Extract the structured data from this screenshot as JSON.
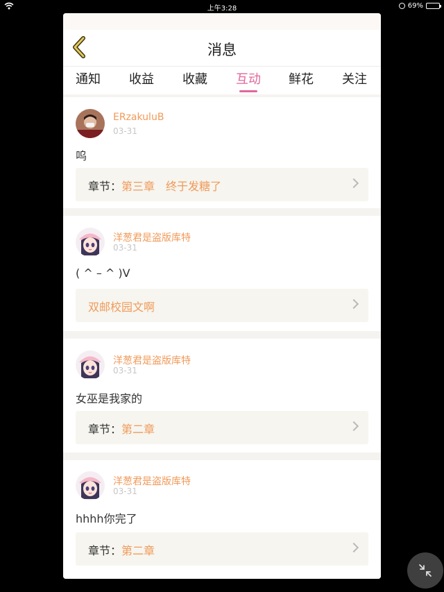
{
  "status_bar": {
    "time": "上午3:28",
    "battery_text": "69%",
    "battery_level": 0.69
  },
  "header": {
    "title": "消息",
    "back_icon": "back-chevron-icon"
  },
  "tabs": [
    {
      "label": "通知",
      "active": false
    },
    {
      "label": "收益",
      "active": false
    },
    {
      "label": "收藏",
      "active": false
    },
    {
      "label": "互动",
      "active": true
    },
    {
      "label": "鲜花",
      "active": false
    },
    {
      "label": "关注",
      "active": false
    }
  ],
  "messages": [
    {
      "user": "ERzakuluB",
      "date": "03-31",
      "comment": "呜",
      "ref_prefix": "章节：",
      "ref_title": "第三章　终于发糖了"
    },
    {
      "user": "洋葱君是盗版库特",
      "date": "03-31",
      "comment": "( ^ – ^ )V",
      "ref_prefix": "",
      "ref_title": "双邮校园文啊"
    },
    {
      "user": "洋葱君是盗版库特",
      "date": "03-31",
      "comment": "女巫是我家的",
      "ref_prefix": "章节：",
      "ref_title": "第二章"
    },
    {
      "user": "洋葱君是盗版库特",
      "date": "03-31",
      "comment": "hhhh你完了",
      "ref_prefix": "章节：",
      "ref_title": "第二章"
    }
  ],
  "colors": {
    "accent_pink": "#e0679b",
    "accent_orange": "#f09a5a",
    "back_yellow": "#e2c95a"
  },
  "floating_button_icon": "collapse-arrows-icon"
}
